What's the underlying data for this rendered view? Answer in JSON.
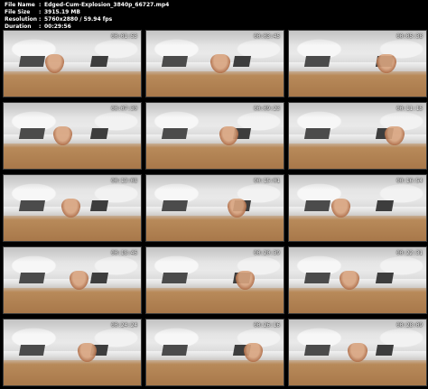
{
  "file_info": [
    {
      "label": "File Name",
      "value": "Edged-Cum-Explosion_3840p_66727.mp4"
    },
    {
      "label": "File Size",
      "value": "3915.19 MB"
    },
    {
      "label": "Resolution",
      "value": "5760x2880 / 59.94 fps"
    },
    {
      "label": "Duration",
      "value": "00:29:56"
    }
  ],
  "separator": ":",
  "thumbnails": [
    {
      "timestamp": "00:01:53"
    },
    {
      "timestamp": "00:03:45"
    },
    {
      "timestamp": "00:05:38"
    },
    {
      "timestamp": "00:07:30"
    },
    {
      "timestamp": "00:09:23"
    },
    {
      "timestamp": "00:11:15"
    },
    {
      "timestamp": "00:13:08"
    },
    {
      "timestamp": "00:15:01"
    },
    {
      "timestamp": "00:16:54"
    },
    {
      "timestamp": "00:18:46"
    },
    {
      "timestamp": "00:20:39"
    },
    {
      "timestamp": "00:22:31"
    },
    {
      "timestamp": "00:24:24"
    },
    {
      "timestamp": "00:26:16"
    },
    {
      "timestamp": "00:28:09"
    }
  ]
}
